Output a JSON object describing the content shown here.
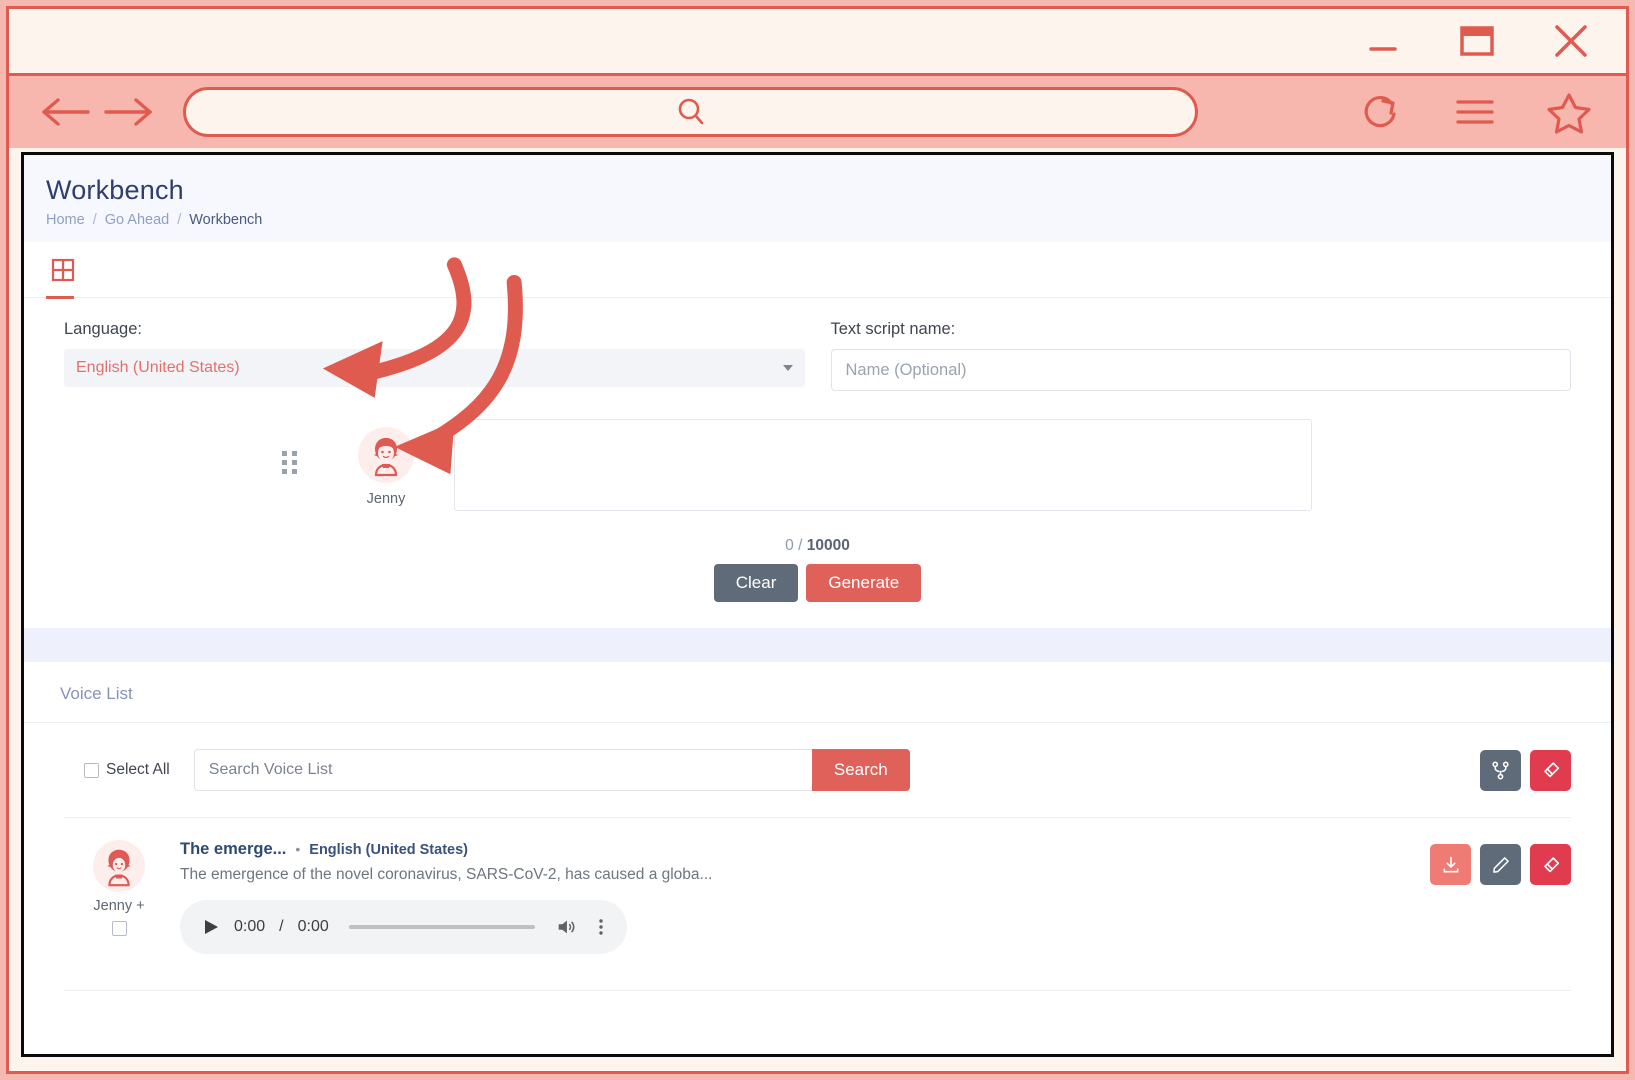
{
  "window": {
    "minimize_label": "Minimize",
    "maximize_label": "Maximize",
    "close_label": "Close"
  },
  "browser": {
    "back_label": "Back",
    "forward_label": "Forward",
    "address_value": "",
    "address_placeholder": "",
    "reload_label": "Reload",
    "menu_label": "Menu",
    "bookmark_label": "Bookmark"
  },
  "page": {
    "title": "Workbench",
    "breadcrumb": [
      {
        "label": "Home",
        "active": false
      },
      {
        "label": "Go Ahead",
        "active": false
      },
      {
        "label": "Workbench",
        "active": true
      }
    ],
    "separator": "/"
  },
  "tabs": [
    {
      "id": "grid",
      "icon": "grid-icon",
      "active": true
    }
  ],
  "form": {
    "language_label": "Language:",
    "language_value": "English (United States)",
    "script_name_label": "Text script name:",
    "script_name_value": "",
    "script_name_placeholder": "Name (Optional)"
  },
  "composer": {
    "speaker_name": "Jenny",
    "script_value": "",
    "script_placeholder": "",
    "counter_current": "0",
    "counter_separator": "/",
    "counter_max": "10000",
    "clear_label": "Clear",
    "generate_label": "Generate"
  },
  "voice_list": {
    "heading": "Voice List",
    "select_all_label": "Select All",
    "search_value": "",
    "search_placeholder": "Search Voice List",
    "search_button": "Search",
    "toolbar_actions": [
      {
        "name": "merge-button",
        "icon": "merge-icon",
        "style": "ib-gray"
      },
      {
        "name": "delete-all-button",
        "icon": "eraser-icon",
        "style": "ib-red"
      }
    ],
    "items": [
      {
        "speaker": "Jenny +",
        "title": "The emerge...",
        "dot": "•",
        "language": "English (United States)",
        "description": "The emergence of the novel coronavirus, SARS-CoV-2, has caused a globa...",
        "audio": {
          "current_time": "0:00",
          "time_separator": "/",
          "duration": "0:00",
          "progress_percent": 0
        },
        "actions": [
          {
            "name": "download-button",
            "icon": "download-icon",
            "style": "ib-salmon"
          },
          {
            "name": "edit-button",
            "icon": "pencil-icon",
            "style": "ib-gray"
          },
          {
            "name": "delete-button",
            "icon": "eraser-icon",
            "style": "ib-red"
          }
        ]
      }
    ]
  },
  "colors": {
    "accent_red": "#e05b4f",
    "frame_pink": "#f7b7ae",
    "titlebar_cream": "#fdf4ee",
    "header_blue": "#2f3e6e",
    "button_gray": "#5f6b78",
    "button_red": "#e0605a",
    "annotation_red": "#e05b4f"
  }
}
